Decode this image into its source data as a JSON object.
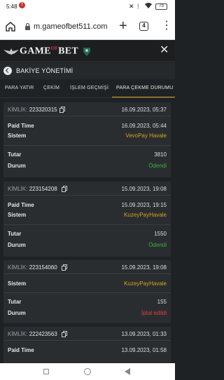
{
  "status_bar": {
    "time": "5:48",
    "notification_badge": "!",
    "battery": "73"
  },
  "browser": {
    "url": "m.gameofbet511.com",
    "tab_count": "4",
    "icons": [
      "home-icon",
      "lock-icon",
      "plus-icon",
      "tabs-icon",
      "more-icon"
    ]
  },
  "site": {
    "logo_text_left": "GAME",
    "logo_text_of": "OF",
    "logo_text_right": "BET"
  },
  "page": {
    "title": "BAKİYE YÖNETİMİ"
  },
  "tabs": [
    {
      "label": "PARA YATIR"
    },
    {
      "label": "ÇEKİM"
    },
    {
      "label": "İŞLEM GEÇMİŞİ"
    },
    {
      "label": "PARA ÇEKME DURUMU",
      "active": true
    }
  ],
  "cards": [
    {
      "kimlik_label": "KİMLİK:",
      "id": "223320315",
      "date": "16.09.2023, 05:37",
      "paid_time_label": "Paid Time",
      "paid_time": "16.09.2023, 05:44",
      "sistem_label": "Sistem",
      "sistem": "VevoPay Havale",
      "tutar_label": "Tutar",
      "tutar": "3810",
      "durum_label": "Durum",
      "durum": "Ödendi",
      "durum_color": "#3fae3a"
    },
    {
      "kimlik_label": "KİMLİK:",
      "id": "223154208",
      "date": "15.09.2023, 19:08",
      "paid_time_label": "Paid Time",
      "paid_time": "15.09.2023, 19:15",
      "sistem_label": "Sistem",
      "sistem": "KuzeyPayHavale",
      "tutar_label": "Tutar",
      "tutar": "1550",
      "durum_label": "Durum",
      "durum": "Ödendi",
      "durum_color": "#3fae3a"
    },
    {
      "kimlik_label": "KİMLİK:",
      "id": "223154060",
      "date": "15.09.2023, 19:08",
      "sistem_label": "Sistem",
      "sistem": "KuzeyPayHavale",
      "tutar_label": "Tutar",
      "tutar": "155",
      "durum_label": "Durum",
      "durum": "İptal edildi",
      "durum_color": "#e2403c"
    },
    {
      "kimlik_label": "KİMLİK:",
      "id": "222423563",
      "date": "13.09.2023, 01:33",
      "paid_time_label": "Paid Time",
      "paid_time": "13.09.2023, 01:58"
    }
  ],
  "colors": {
    "accent": "#e0a92a",
    "system_text": "#d4a21c",
    "paid": "#3fae3a",
    "cancelled": "#e2403c",
    "background": "#1f2224",
    "card": "#2a2d30"
  }
}
